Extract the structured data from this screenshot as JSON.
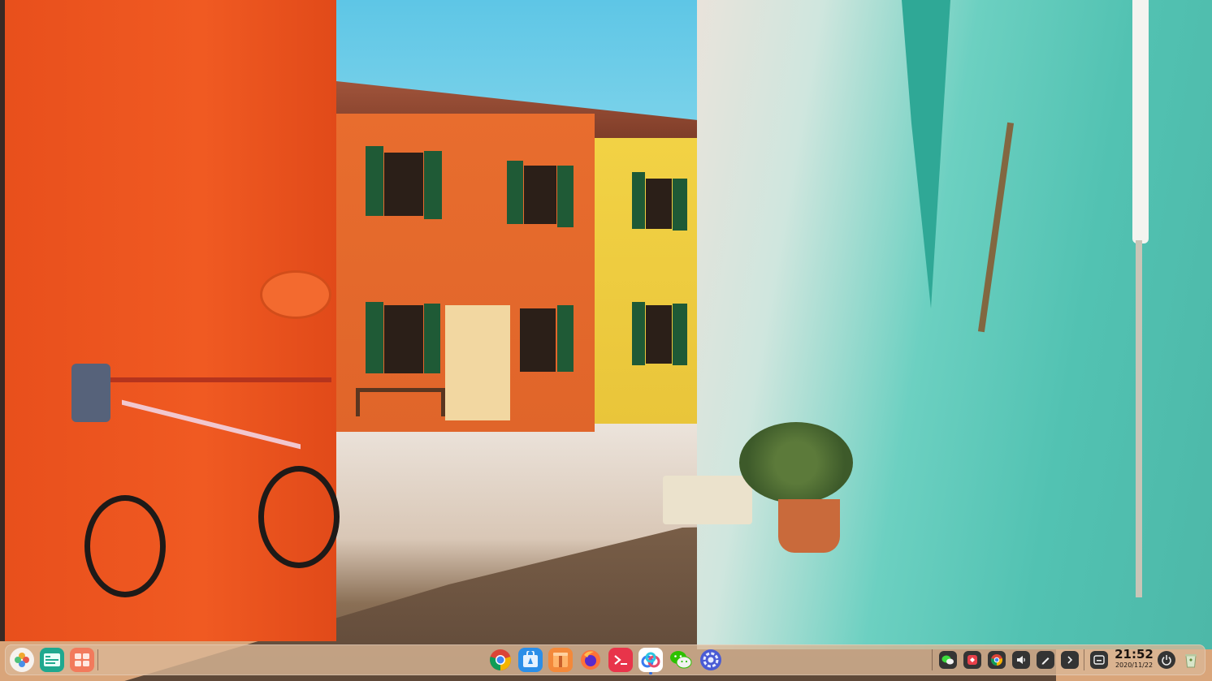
{
  "wallpaper": {
    "description_icon": "burano-street-wallpaper"
  },
  "dock": {
    "left_items": [
      {
        "name": "launcher",
        "icon": "launcher-icon"
      },
      {
        "name": "multitask-view",
        "icon": "multitask-view-icon"
      },
      {
        "name": "show-desktop",
        "icon": "workspace-icon"
      }
    ],
    "center_apps": [
      {
        "name": "google-chrome",
        "icon": "chrome-icon"
      },
      {
        "name": "app-store",
        "icon": "app-store-icon"
      },
      {
        "name": "archive-manager",
        "icon": "archive-icon"
      },
      {
        "name": "firefox",
        "icon": "firefox-icon"
      },
      {
        "name": "terminal",
        "icon": "terminal-icon"
      },
      {
        "name": "baidu-netdisk",
        "icon": "cloud-icon",
        "active": true
      },
      {
        "name": "wechat",
        "icon": "wechat-icon"
      },
      {
        "name": "control-center",
        "icon": "settings-icon"
      }
    ],
    "tray": [
      {
        "name": "wechat-tray",
        "icon": "wechat-tray-icon"
      },
      {
        "name": "wps-tray",
        "icon": "wps-icon"
      },
      {
        "name": "chrome-tray",
        "icon": "chrome-tray-icon"
      },
      {
        "name": "volume",
        "icon": "volume-icon"
      },
      {
        "name": "screenshot",
        "icon": "pen-icon"
      },
      {
        "name": "expand-tray",
        "icon": "chevron-right-icon"
      },
      {
        "name": "notifications",
        "icon": "notification-icon"
      }
    ],
    "clock": {
      "time": "21:52",
      "date": "2020/11/22"
    },
    "power": {
      "icon": "power-icon"
    },
    "trash": {
      "icon": "trash-icon"
    }
  }
}
